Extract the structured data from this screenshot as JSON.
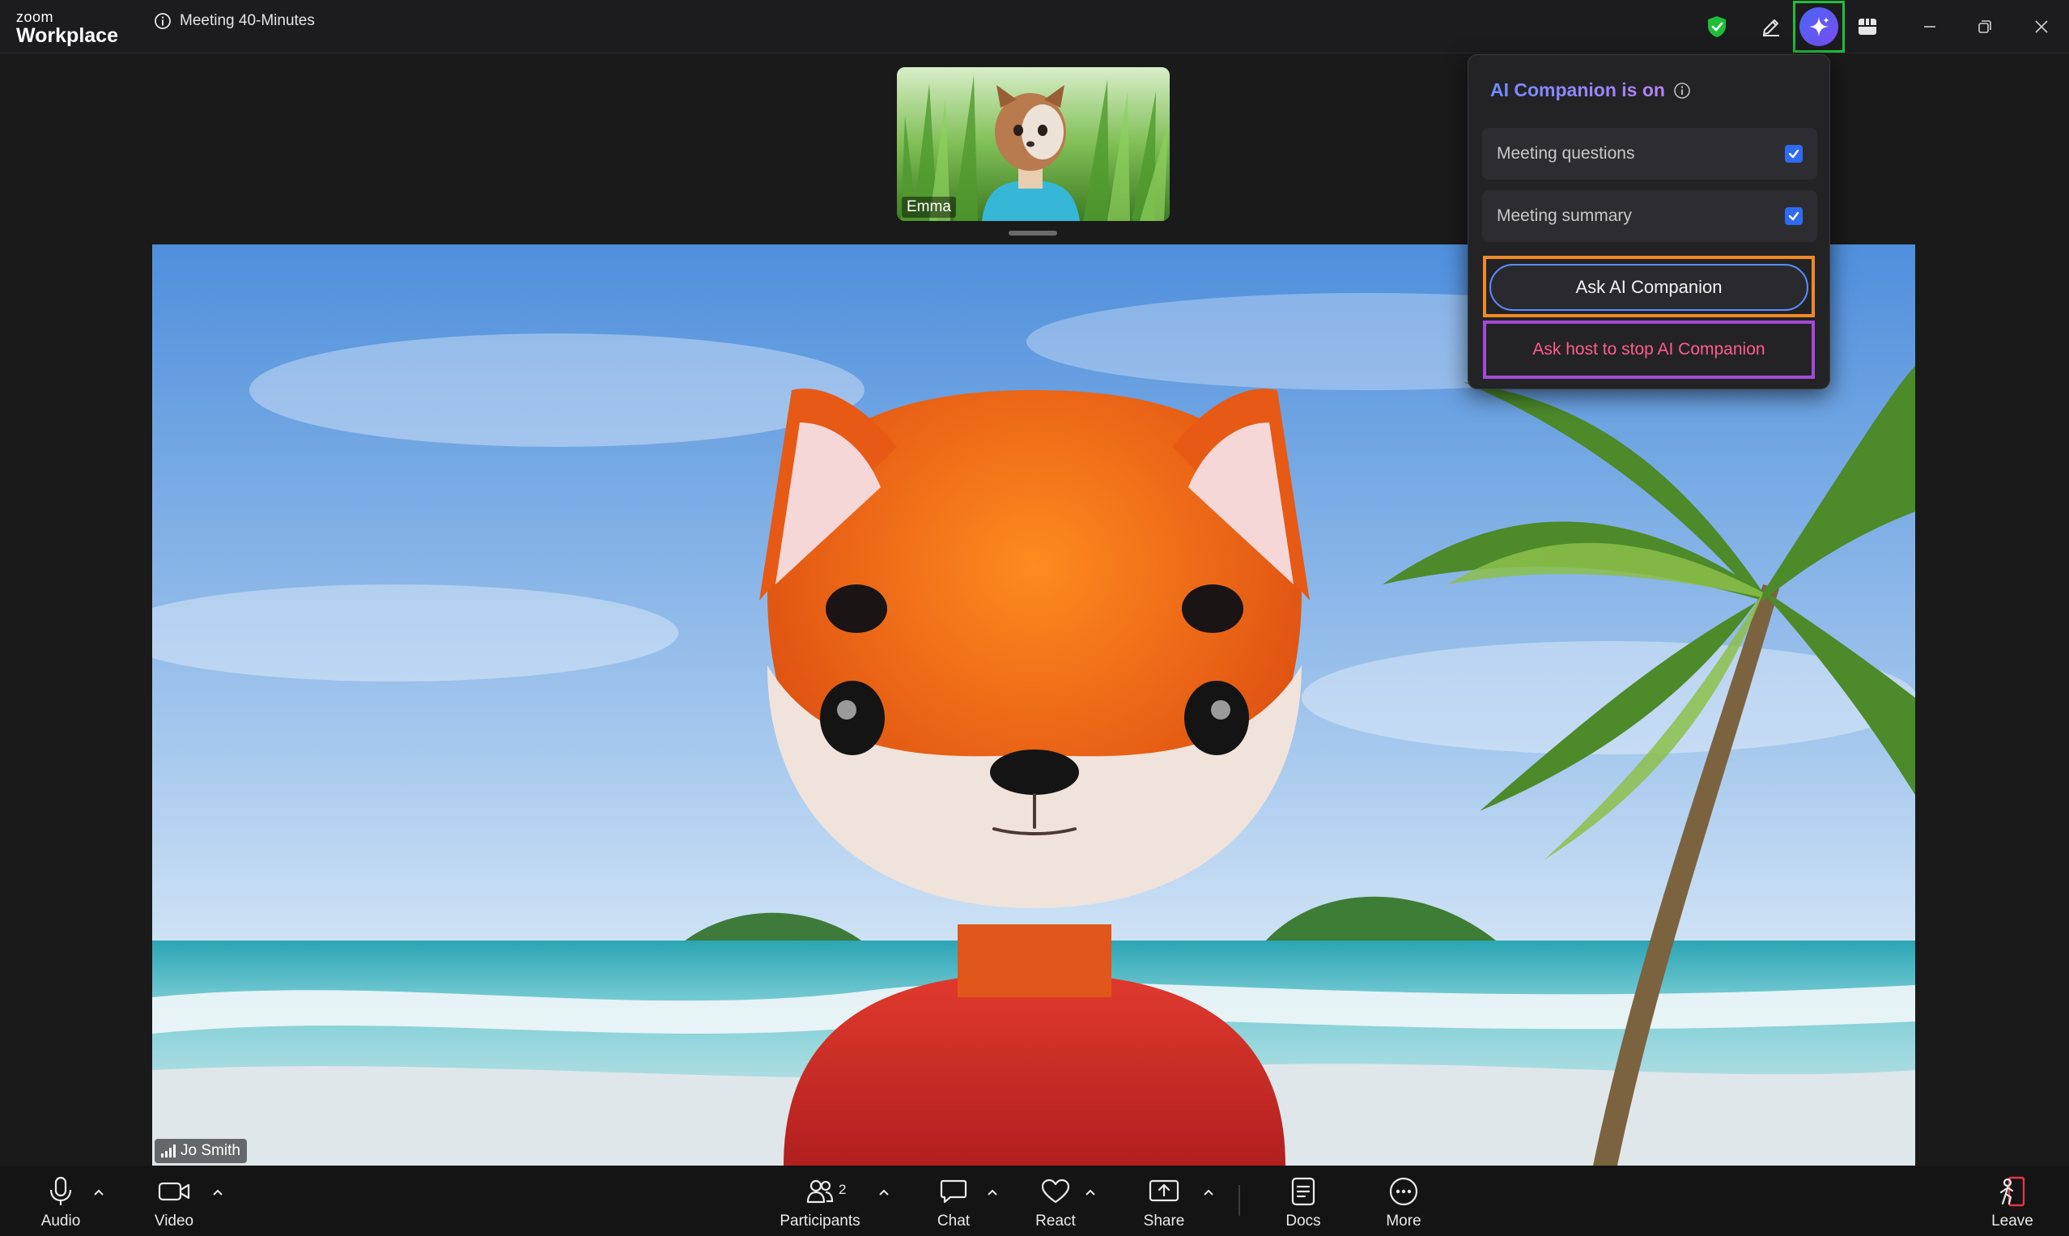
{
  "app": {
    "logo_top": "zoom",
    "logo_bottom": "Workplace",
    "meeting_title": "Meeting 40-Minutes"
  },
  "thumbnail": {
    "name": "Emma"
  },
  "main_video": {
    "name": "Jo Smith"
  },
  "ai_panel": {
    "title": "AI Companion is on",
    "options": [
      {
        "label": "Meeting questions",
        "checked": true
      },
      {
        "label": "Meeting summary",
        "checked": true
      }
    ],
    "ask_button": "Ask AI Companion",
    "stop_button": "Ask host to stop AI Companion"
  },
  "toolbar": {
    "audio": "Audio",
    "video": "Video",
    "participants": "Participants",
    "participant_count": "2",
    "chat": "Chat",
    "react": "React",
    "share": "Share",
    "docs": "Docs",
    "more": "More",
    "leave": "Leave"
  },
  "colors": {
    "accent_ai": "#4a64f5",
    "security_green": "#1fbf3a",
    "highlight_orange": "#f08a24",
    "highlight_purple": "#a44ad8",
    "stop_text": "#ff5d8a",
    "leave_red": "#e5334b"
  },
  "icons": [
    "info-icon",
    "shield-check-icon",
    "pencil-icon",
    "ai-sparkle-icon",
    "apps-grid-icon",
    "minimize-icon",
    "restore-icon",
    "close-icon",
    "microphone-icon",
    "camera-icon",
    "participants-icon",
    "chat-icon",
    "heart-icon",
    "share-screen-icon",
    "docs-icon",
    "more-icon",
    "leave-icon",
    "signal-icon",
    "checkbox-icon"
  ]
}
